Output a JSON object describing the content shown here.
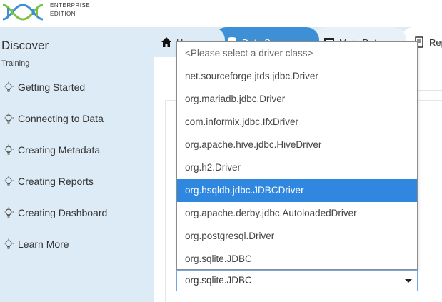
{
  "app": {
    "logo_line1": "ENTERPRISE",
    "logo_line2": "EDITION",
    "colors": {
      "sidebar_bg": "#dcebf5",
      "active_tab": "#3d8fd6",
      "selected_option": "#2f87e0"
    }
  },
  "sidebar": {
    "title": "Discover",
    "subtitle": "Training",
    "items": [
      {
        "label": "Getting Started",
        "icon": "lightbulb-icon"
      },
      {
        "label": "Connecting to Data",
        "icon": "lightbulb-icon"
      },
      {
        "label": "Creating Metadata",
        "icon": "lightbulb-icon"
      },
      {
        "label": "Creating Reports",
        "icon": "lightbulb-icon"
      },
      {
        "label": "Creating Dashboard",
        "icon": "lightbulb-icon"
      },
      {
        "label": "Learn More",
        "icon": "lightbulb-icon"
      }
    ]
  },
  "tabs": [
    {
      "label": "Home",
      "icon": "home-icon"
    },
    {
      "label": "Data Sources",
      "icon": "database-icon",
      "active": true
    },
    {
      "label": "Meta Data",
      "icon": "metadata-icon"
    },
    {
      "label": "Rep",
      "icon": "report-icon"
    }
  ],
  "driver_select": {
    "value": "org.sqlite.JDBC",
    "options": [
      "<Please select a driver class>",
      "net.sourceforge.jtds.jdbc.Driver",
      "org.mariadb.jdbc.Driver",
      "com.informix.jdbc.IfxDriver",
      "org.apache.hive.jdbc.HiveDriver",
      "org.h2.Driver",
      "org.hsqldb.jdbc.JDBCDriver",
      "org.apache.derby.jdbc.AutoloadedDriver",
      "org.postgresql.Driver",
      "org.sqlite.JDBC"
    ],
    "highlighted": "org.hsqldb.jdbc.JDBCDriver"
  }
}
